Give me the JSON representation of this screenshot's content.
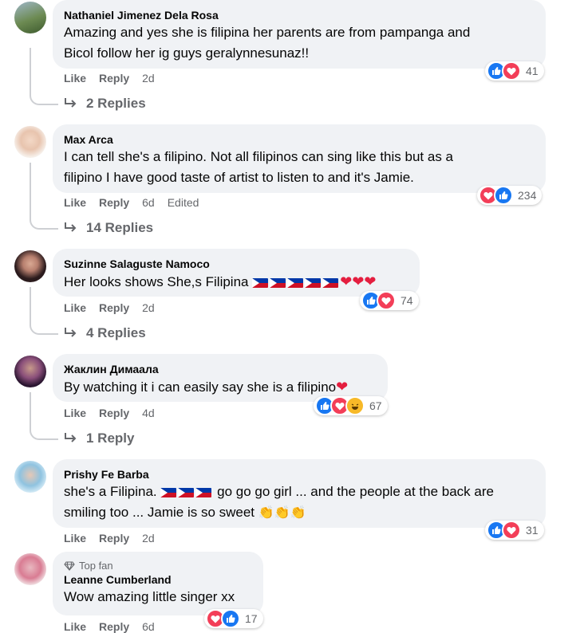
{
  "comments": [
    {
      "author": "Nathaniel Jimenez Dela Rosa",
      "text_line1": "Amazing and yes she is filipina her parents are from pampanga and",
      "text_line2": "Bicol follow her ig guys geralynnesunaz!!",
      "like": "Like",
      "reply": "Reply",
      "time": "2d",
      "reaction_count": "41",
      "replies_label": "2 Replies"
    },
    {
      "author": "Max Arca",
      "text_line1": "I can tell she's a filipino. Not all filipinos can sing like this but as a",
      "text_line2": "filipino I have good taste of artist to listen to and it's Jamie.",
      "like": "Like",
      "reply": "Reply",
      "time": "6d",
      "edited": "Edited",
      "reaction_count": "234",
      "replies_label": "14 Replies"
    },
    {
      "author": "Suzinne Salaguste Namoco",
      "text_line1": "Her looks shows She,s Filipina",
      "like": "Like",
      "reply": "Reply",
      "time": "2d",
      "reaction_count": "74",
      "replies_label": "4 Replies"
    },
    {
      "author": "Жаклин Димаала",
      "text_line1": "By watching it i can easily say she is a filipino",
      "like": "Like",
      "reply": "Reply",
      "time": "4d",
      "reaction_count": "67",
      "replies_label": "1 Reply"
    },
    {
      "author": "Prishy Fe Barba",
      "text_prefix": "she's a Filipina.",
      "text_suffix": "go go go girl ... and the people at the back are",
      "text_line2": "smiling too ... Jamie is so sweet",
      "like": "Like",
      "reply": "Reply",
      "time": "2d",
      "reaction_count": "31"
    },
    {
      "badge": "Top fan",
      "author": "Leanne Cumberland",
      "text_line1": "Wow amazing little singer xx",
      "like": "Like",
      "reply": "Reply",
      "time": "6d",
      "reaction_count": "17"
    }
  ],
  "colors": {
    "like": "#1877f2",
    "love": "#f33e58",
    "haha": "#f7b928",
    "bubble": "#f0f2f5",
    "meta": "#65676b"
  },
  "icons": [
    "like-reaction-icon",
    "love-reaction-icon",
    "haha-reaction-icon",
    "reply-arrow-icon",
    "diamond-icon",
    "philippines-flag-icon",
    "heart-emoji-icon",
    "clapping-hands-icon"
  ]
}
